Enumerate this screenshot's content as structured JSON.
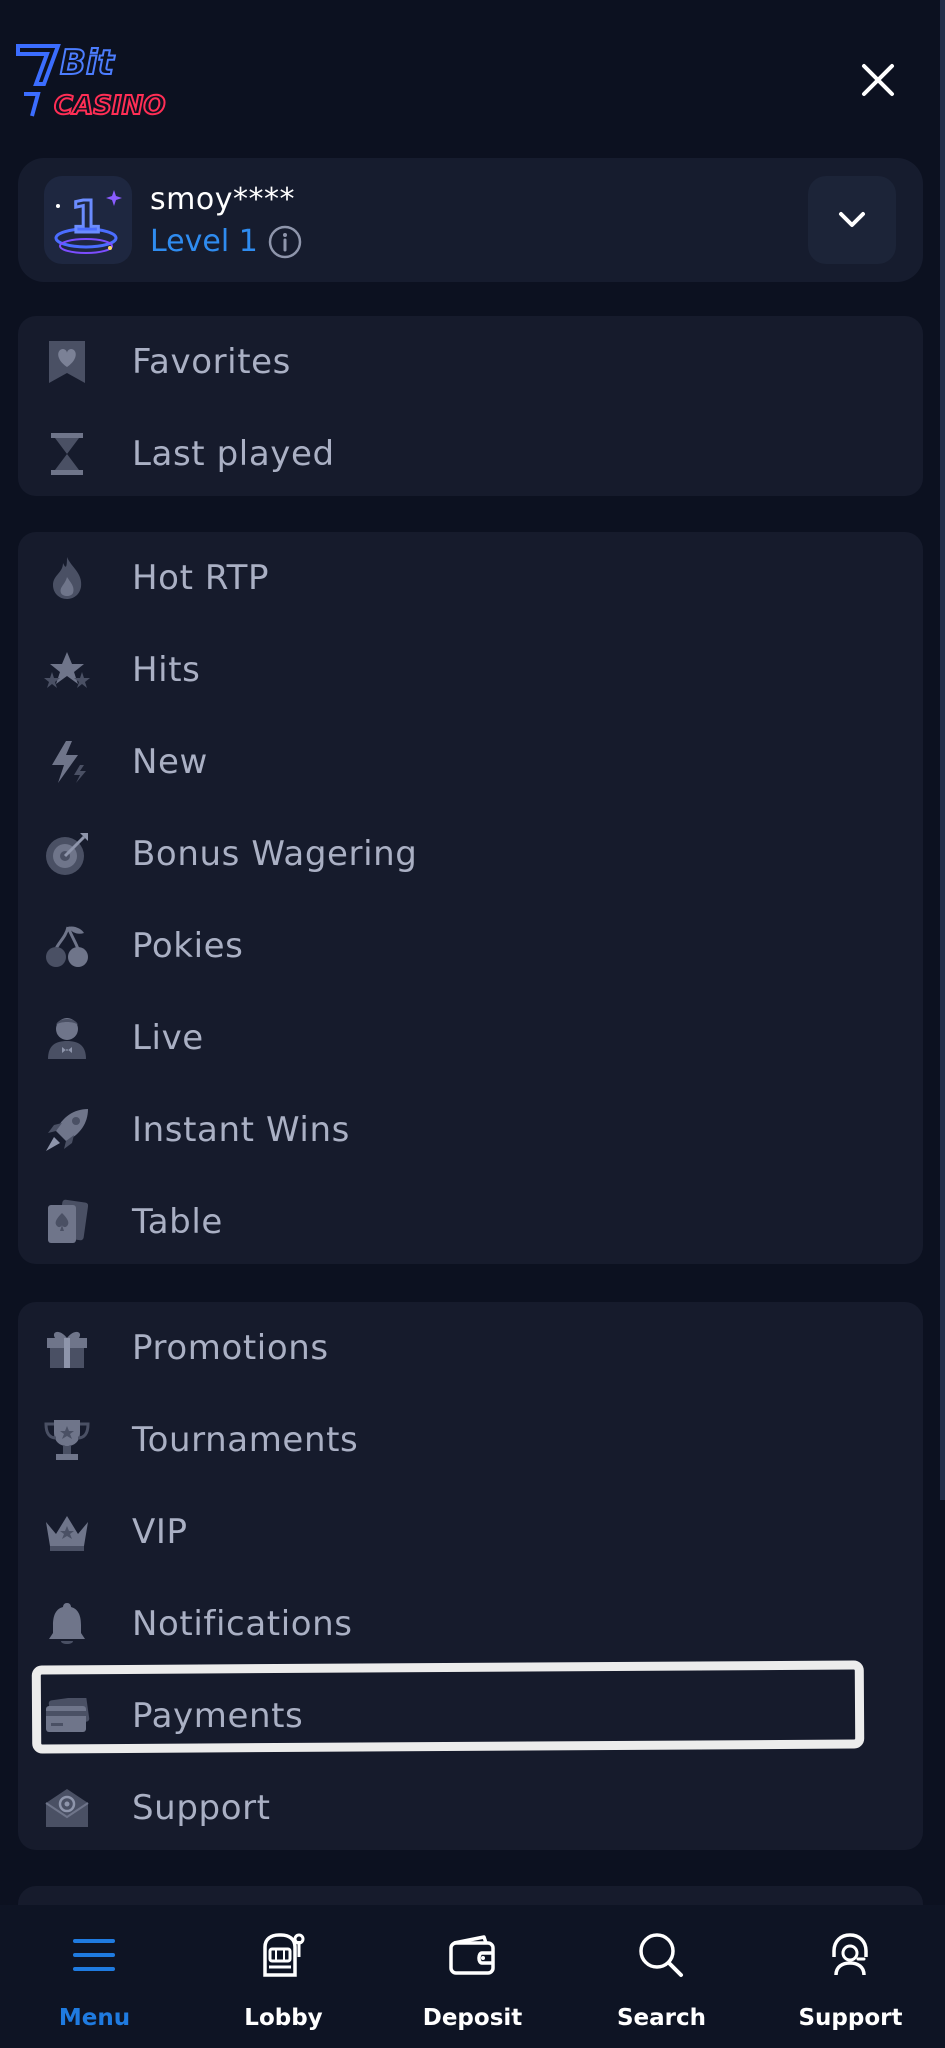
{
  "brand": {
    "logo_top": "7Bit",
    "logo_bottom": "CASINO",
    "accent": "#2f8cf0",
    "logo_blue": "#3b6dff",
    "logo_red": "#ff2e55"
  },
  "user": {
    "badge_number": "1",
    "name": "smoy****",
    "level": "Level 1"
  },
  "sections": [
    {
      "items": [
        {
          "id": "favorites",
          "label": "Favorites",
          "icon": "heart-bookmark-icon"
        },
        {
          "id": "last-played",
          "label": "Last played",
          "icon": "hourglass-icon"
        }
      ]
    },
    {
      "items": [
        {
          "id": "hot-rtp",
          "label": "Hot RTP",
          "icon": "flame-icon"
        },
        {
          "id": "hits",
          "label": "Hits",
          "icon": "stars-icon"
        },
        {
          "id": "new",
          "label": "New",
          "icon": "lightning-icon"
        },
        {
          "id": "bonus-wagering",
          "label": "Bonus Wagering",
          "icon": "target-icon"
        },
        {
          "id": "pokies",
          "label": "Pokies",
          "icon": "cherries-icon"
        },
        {
          "id": "live",
          "label": "Live",
          "icon": "dealer-icon"
        },
        {
          "id": "instant-wins",
          "label": "Instant Wins",
          "icon": "rocket-icon"
        },
        {
          "id": "table",
          "label": "Table",
          "icon": "playing-cards-icon"
        }
      ]
    },
    {
      "items": [
        {
          "id": "promotions",
          "label": "Promotions",
          "icon": "gift-icon"
        },
        {
          "id": "tournaments",
          "label": "Tournaments",
          "icon": "trophy-icon"
        },
        {
          "id": "vip",
          "label": "VIP",
          "icon": "crown-icon"
        },
        {
          "id": "notifications",
          "label": "Notifications",
          "icon": "bell-icon"
        },
        {
          "id": "payments",
          "label": "Payments",
          "icon": "credit-card-icon"
        },
        {
          "id": "support",
          "label": "Support",
          "icon": "envelope-at-icon"
        }
      ]
    }
  ],
  "bottom_nav": [
    {
      "id": "menu",
      "label": "Menu",
      "icon": "hamburger-icon",
      "active": true
    },
    {
      "id": "lobby",
      "label": "Lobby",
      "icon": "slot-machine-icon",
      "active": false
    },
    {
      "id": "deposit",
      "label": "Deposit",
      "icon": "wallet-icon",
      "active": false
    },
    {
      "id": "search",
      "label": "Search",
      "icon": "search-icon",
      "active": false
    },
    {
      "id": "support",
      "label": "Support",
      "icon": "headset-icon",
      "active": false
    }
  ]
}
